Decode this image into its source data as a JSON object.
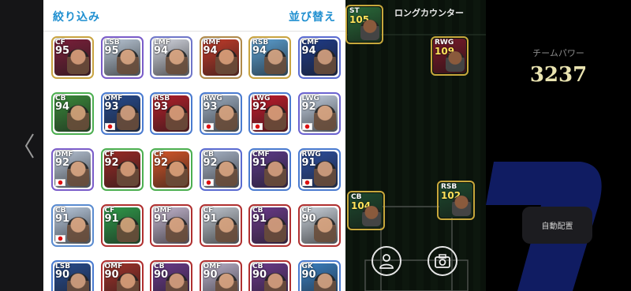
{
  "header": {
    "filter_label": "絞り込み",
    "sort_label": "並び替え"
  },
  "cards": [
    {
      "pos": "CF",
      "rating": "95",
      "border": "#c9a441",
      "bg": "#7b1f3a",
      "flag": "es"
    },
    {
      "pos": "LSB",
      "rating": "95",
      "border": "#7a5cc9",
      "bg": "#b9c7d6",
      "flag": "other"
    },
    {
      "pos": "LMF",
      "rating": "94",
      "border": "#6f76c9",
      "bg": "#d3d6e0",
      "flag": "other"
    },
    {
      "pos": "RMF",
      "rating": "94",
      "border": "#b08a4a",
      "bg": "#c23b2a",
      "flag": "other"
    },
    {
      "pos": "RSB",
      "rating": "94",
      "border": "#c9a441",
      "bg": "#5b9fd1",
      "flag": "other"
    },
    {
      "pos": "CMF",
      "rating": "94",
      "border": "#5a6bd1",
      "bg": "#1f3c8a",
      "flag": "other"
    },
    {
      "pos": "CB",
      "rating": "94",
      "border": "#4caf50",
      "bg": "#3a8a3a",
      "flag": "other"
    },
    {
      "pos": "OMF",
      "rating": "93",
      "border": "#4a7bd0",
      "bg": "#274b8f",
      "flag": "jp"
    },
    {
      "pos": "RSB",
      "rating": "93",
      "border": "#4a7bd0",
      "bg": "#b31f2a",
      "flag": "other"
    },
    {
      "pos": "RWG",
      "rating": "93",
      "border": "#4a7bd0",
      "bg": "#9fb0c4",
      "flag": "jp"
    },
    {
      "pos": "LWG",
      "rating": "92",
      "border": "#4a7bd0",
      "bg": "#c21b2b",
      "flag": "jp"
    },
    {
      "pos": "LWG",
      "rating": "92",
      "border": "#6b63d0",
      "bg": "#c2cfe0",
      "flag": "jp"
    },
    {
      "pos": "DMF",
      "rating": "92",
      "border": "#7a5cc9",
      "bg": "#b7c4d6",
      "flag": "jp"
    },
    {
      "pos": "CF",
      "rating": "92",
      "border": "#4caf50",
      "bg": "#9a2a26",
      "flag": "other"
    },
    {
      "pos": "CF",
      "rating": "92",
      "border": "#4caf50",
      "bg": "#d4572a",
      "flag": "other"
    },
    {
      "pos": "CB",
      "rating": "92",
      "border": "#5a6bd1",
      "bg": "#a7b3c6",
      "flag": "jp"
    },
    {
      "pos": "CMF",
      "rating": "91",
      "border": "#4a7bd0",
      "bg": "#5d3a8a",
      "flag": "other"
    },
    {
      "pos": "RWG",
      "rating": "91",
      "border": "#4a7bd0",
      "bg": "#2d4fa0",
      "flag": "jp"
    },
    {
      "pos": "CB",
      "rating": "91",
      "border": "#5a8bd0",
      "bg": "#b8c9de",
      "flag": "jp"
    },
    {
      "pos": "CF",
      "rating": "91",
      "border": "#b03030",
      "bg": "#2f9a4a",
      "flag": "other"
    },
    {
      "pos": "DMF",
      "rating": "91",
      "border": "#b03030",
      "bg": "#c4b7d0",
      "flag": "other"
    },
    {
      "pos": "CF",
      "rating": "91",
      "border": "#b03030",
      "bg": "#bfc6cf",
      "flag": "other"
    },
    {
      "pos": "CB",
      "rating": "91",
      "border": "#b03030",
      "bg": "#6a3a8a",
      "flag": "other"
    },
    {
      "pos": "CF",
      "rating": "90",
      "border": "#b03030",
      "bg": "#c9d1da",
      "flag": "other"
    },
    {
      "pos": "LSB",
      "rating": "90",
      "border": "#4a7bd0",
      "bg": "#274b8f",
      "flag": "other"
    },
    {
      "pos": "OMF",
      "rating": "90",
      "border": "#b03030",
      "bg": "#a0322a",
      "flag": "other"
    },
    {
      "pos": "CB",
      "rating": "90",
      "border": "#b03030",
      "bg": "#6a3a8a",
      "flag": "other"
    },
    {
      "pos": "OMF",
      "rating": "90",
      "border": "#b03030",
      "bg": "#b9b0c9",
      "flag": "other"
    },
    {
      "pos": "CB",
      "rating": "90",
      "border": "#b03030",
      "bg": "#6a3a8a",
      "flag": "other"
    },
    {
      "pos": "GK",
      "rating": "90",
      "border": "#4a7bd0",
      "bg": "#3a7fc0",
      "flag": "other"
    }
  ],
  "pitch": {
    "title": "ロングカウンター",
    "players": [
      {
        "pos": "ST",
        "rating": "105",
        "bg": "#2a6a3a"
      },
      {
        "pos": "RWG",
        "rating": "109",
        "bg": "#7a1a2a"
      },
      {
        "pos": "CB",
        "rating": "104",
        "bg": "#1f4a2f"
      },
      {
        "pos": "RSB",
        "rating": "102",
        "bg": "#1f4a2f"
      }
    ],
    "profile_icon": "person-icon",
    "camera_icon": "camera-icon"
  },
  "team": {
    "power_label": "チームパワー",
    "power_value": "3237",
    "auto_label": "自動配置"
  },
  "colors": {
    "accent_blue": "#1f8fd0",
    "power_gold": "#e9e3b0",
    "right_deco_blue": "#1a2a8a"
  }
}
